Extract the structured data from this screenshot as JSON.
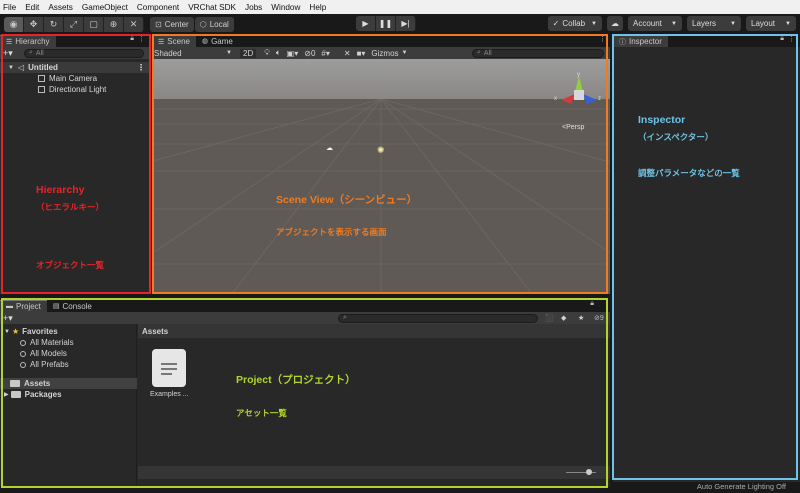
{
  "menu": [
    "File",
    "Edit",
    "Assets",
    "GameObject",
    "Component",
    "VRChat SDK",
    "Jobs",
    "Window",
    "Help"
  ],
  "toolbar": {
    "center_label": "Center",
    "local_label": "Local",
    "collab_label": "Collab",
    "account_label": "Account",
    "layers_label": "Layers",
    "layout_label": "Layout"
  },
  "hierarchy": {
    "tab": "Hierarchy",
    "search_placeholder": "All",
    "scene": "Untitled",
    "items": [
      "Main Camera",
      "Directional Light"
    ]
  },
  "scene": {
    "tabs": [
      "Scene",
      "Game"
    ],
    "shading": "Shaded",
    "mode_2d": "2D",
    "fx_count": "0",
    "gizmos": "Gizmos",
    "search_placeholder": "All",
    "persp": "Persp"
  },
  "inspector": {
    "tab": "Inspector"
  },
  "project": {
    "tabs": [
      "Project",
      "Console"
    ],
    "favorites_label": "Favorites",
    "favorites": [
      "All Materials",
      "All Models",
      "All Prefabs"
    ],
    "assets_label": "Assets",
    "packages_label": "Packages",
    "breadcrumb": "Assets",
    "asset_item": "Examples ...",
    "badge_count": "9"
  },
  "status": {
    "text": "Auto Generate Lighting Off"
  },
  "annotations": {
    "hierarchy_en": "Hierarchy",
    "hierarchy_jp": "（ヒエラルキー）",
    "hierarchy_desc": "オブジェクト一覧",
    "scene_title": "Scene View（シーンビュー）",
    "scene_desc": "アブジェクトを表示する画面",
    "inspector_en": "Inspector",
    "inspector_jp": "（インスペクター）",
    "inspector_desc": "調整パラメータなどの一覧",
    "project_title": "Project（プロジェクト）",
    "project_desc": "アセット一覧"
  },
  "colors": {
    "hierarchy_outline": "#e8242a",
    "scene_outline": "#f07b22",
    "project_outline": "#b2d52e",
    "inspector_outline": "#6fc3e6"
  }
}
